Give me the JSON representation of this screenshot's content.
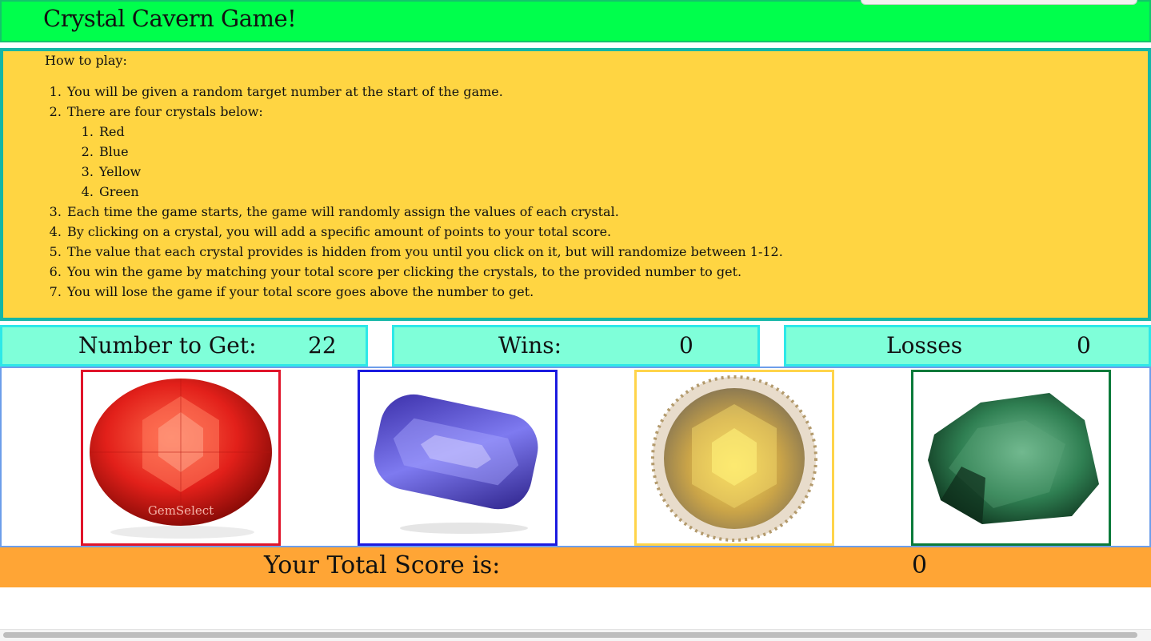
{
  "header": {
    "title": "Crystal Cavern Game!"
  },
  "instructions": {
    "heading": "How to play:",
    "steps": [
      "You will be given a random target number at the start of the game.",
      "There are four crystals below:",
      "Each time the game starts, the game will randomly assign the values of each crystal.",
      "By clicking on a crystal, you will add a specific amount of points to your total score.",
      "The value that each crystal provides is hidden from you until you click on it, but will randomize between 1-12.",
      "You win the game by matching your total score per clicking the crystals, to the provided number to get.",
      "You will lose the game if your total score goes above the number to get."
    ],
    "crystal_colors": [
      "Red",
      "Blue",
      "Yellow",
      "Green"
    ]
  },
  "stats": {
    "target_label": "Number to Get:",
    "target_value": "22",
    "wins_label": "Wins:",
    "wins_value": "0",
    "losses_label": "Losses",
    "losses_value": "0"
  },
  "crystals": [
    {
      "name": "red-crystal",
      "border": "#e0142a",
      "watermark": "GemSelect"
    },
    {
      "name": "blue-crystal",
      "border": "#1b1be0"
    },
    {
      "name": "yellow-crystal",
      "border": "#ffd44a"
    },
    {
      "name": "green-crystal",
      "border": "#0a7a3a"
    }
  ],
  "score": {
    "label": "Your Total Score is:",
    "value": "0"
  },
  "colors": {
    "header_bg": "#00ff4c",
    "instructions_bg": "#ffd542",
    "stat_bg": "#7fffd9",
    "score_bg": "#ffa535"
  }
}
